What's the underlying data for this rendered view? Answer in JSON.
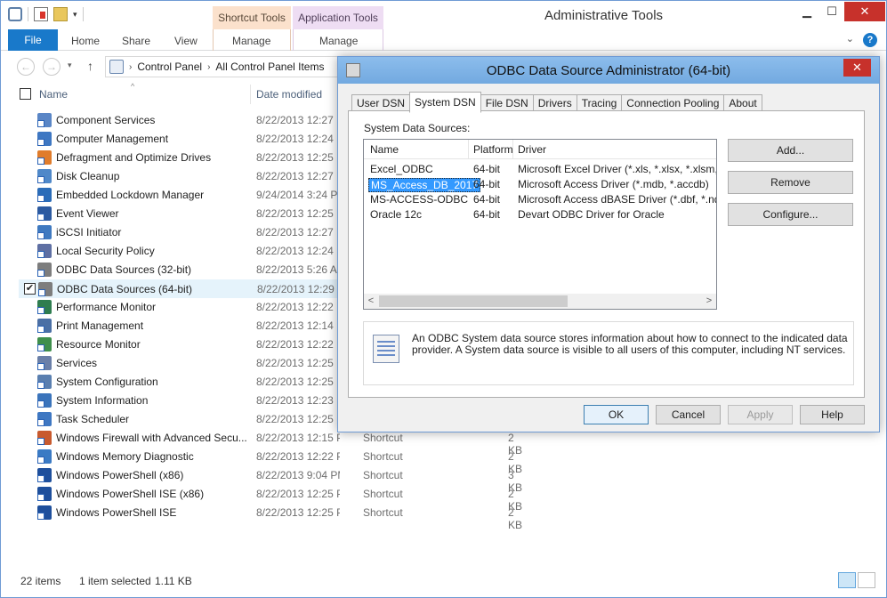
{
  "explorer": {
    "title": "Administrative Tools",
    "context_tabs": [
      "Shortcut Tools",
      "Application Tools"
    ],
    "ribbon_tabs": [
      "File",
      "Home",
      "Share",
      "View"
    ],
    "manage_labels": [
      "Manage",
      "Manage"
    ],
    "breadcrumb": [
      "Control Panel",
      "All Control Panel Items"
    ],
    "columns": {
      "name": "Name",
      "date": "Date modified"
    },
    "files": [
      {
        "name": "Component Services",
        "date": "8/22/2013 12:27 PM",
        "type": "",
        "size": "",
        "icon": "component-services-icon"
      },
      {
        "name": "Computer Management",
        "date": "8/22/2013 12:24 PM",
        "type": "",
        "size": "",
        "icon": "computer-management-icon"
      },
      {
        "name": "Defragment and Optimize Drives",
        "date": "8/22/2013 12:25 PM",
        "type": "",
        "size": "",
        "icon": "defragment-icon"
      },
      {
        "name": "Disk Cleanup",
        "date": "8/22/2013 12:27 PM",
        "type": "",
        "size": "",
        "icon": "disk-cleanup-icon"
      },
      {
        "name": "Embedded Lockdown Manager",
        "date": "9/24/2014 3:24 PM",
        "type": "",
        "size": "",
        "icon": "lockdown-manager-icon"
      },
      {
        "name": "Event Viewer",
        "date": "8/22/2013 12:25 PM",
        "type": "",
        "size": "",
        "icon": "event-viewer-icon"
      },
      {
        "name": "iSCSI Initiator",
        "date": "8/22/2013 12:27 PM",
        "type": "",
        "size": "",
        "icon": "iscsi-icon"
      },
      {
        "name": "Local Security Policy",
        "date": "8/22/2013 12:24 PM",
        "type": "",
        "size": "",
        "icon": "security-policy-icon"
      },
      {
        "name": "ODBC Data Sources (32-bit)",
        "date": "8/22/2013 5:26 AM",
        "type": "",
        "size": "",
        "icon": "odbc-icon"
      },
      {
        "name": "ODBC Data Sources (64-bit)",
        "date": "8/22/2013 12:29 PM",
        "type": "",
        "size": "",
        "icon": "odbc-icon",
        "selected": true
      },
      {
        "name": "Performance Monitor",
        "date": "8/22/2013 12:22 PM",
        "type": "",
        "size": "",
        "icon": "performance-monitor-icon"
      },
      {
        "name": "Print Management",
        "date": "8/22/2013 12:14 PM",
        "type": "",
        "size": "",
        "icon": "print-management-icon"
      },
      {
        "name": "Resource Monitor",
        "date": "8/22/2013 12:22 PM",
        "type": "",
        "size": "",
        "icon": "resource-monitor-icon"
      },
      {
        "name": "Services",
        "date": "8/22/2013 12:25 PM",
        "type": "",
        "size": "",
        "icon": "services-icon"
      },
      {
        "name": "System Configuration",
        "date": "8/22/2013 12:25 PM",
        "type": "",
        "size": "",
        "icon": "system-configuration-icon"
      },
      {
        "name": "System Information",
        "date": "8/22/2013 12:23 PM",
        "type": "",
        "size": "",
        "icon": "system-information-icon"
      },
      {
        "name": "Task Scheduler",
        "date": "8/22/2013 12:25 PM",
        "type": "",
        "size": "",
        "icon": "task-scheduler-icon"
      },
      {
        "name": "Windows Firewall with Advanced Secu...",
        "date": "8/22/2013 12:15 PM",
        "type": "Shortcut",
        "size": "2 KB",
        "icon": "firewall-icon"
      },
      {
        "name": "Windows Memory Diagnostic",
        "date": "8/22/2013 12:22 PM",
        "type": "Shortcut",
        "size": "2 KB",
        "icon": "memory-diagnostic-icon"
      },
      {
        "name": "Windows PowerShell (x86)",
        "date": "8/22/2013 9:04 PM",
        "type": "Shortcut",
        "size": "3 KB",
        "icon": "powershell-icon"
      },
      {
        "name": "Windows PowerShell ISE (x86)",
        "date": "8/22/2013 12:25 PM",
        "type": "Shortcut",
        "size": "2 KB",
        "icon": "powershell-ise-icon"
      },
      {
        "name": "Windows PowerShell ISE",
        "date": "8/22/2013 12:25 PM",
        "type": "Shortcut",
        "size": "2 KB",
        "icon": "powershell-ise-icon"
      }
    ],
    "status": {
      "count": "22 items",
      "selection": "1 item selected",
      "size": "1.11 KB"
    }
  },
  "dialog": {
    "title": "ODBC Data Source Administrator (64-bit)",
    "tabs": [
      "User DSN",
      "System DSN",
      "File DSN",
      "Drivers",
      "Tracing",
      "Connection Pooling",
      "About"
    ],
    "active_tab": "System DSN",
    "list_label": "System Data Sources:",
    "list_columns": [
      "Name",
      "Platform",
      "Driver"
    ],
    "sources": [
      {
        "name": "Excel_ODBC",
        "platform": "64-bit",
        "driver": "Microsoft Excel Driver (*.xls, *.xlsx, *.xlsm, *.xlsb"
      },
      {
        "name": "MS_Access_DB_2017",
        "platform": "64-bit",
        "driver": "Microsoft Access Driver (*.mdb, *.accdb)",
        "selected": true
      },
      {
        "name": "MS-ACCESS-ODBC",
        "platform": "64-bit",
        "driver": "Microsoft Access dBASE Driver (*.dbf, *.ndx, *.m"
      },
      {
        "name": "Oracle 12c",
        "platform": "64-bit",
        "driver": "Devart ODBC Driver for Oracle"
      }
    ],
    "buttons": {
      "add": "Add...",
      "remove": "Remove",
      "configure": "Configure...",
      "ok": "OK",
      "cancel": "Cancel",
      "apply": "Apply",
      "help": "Help"
    },
    "info_text": "An ODBC System data source stores information about how to connect to the indicated data provider. A System data source is visible to all users of this computer, including NT services."
  }
}
